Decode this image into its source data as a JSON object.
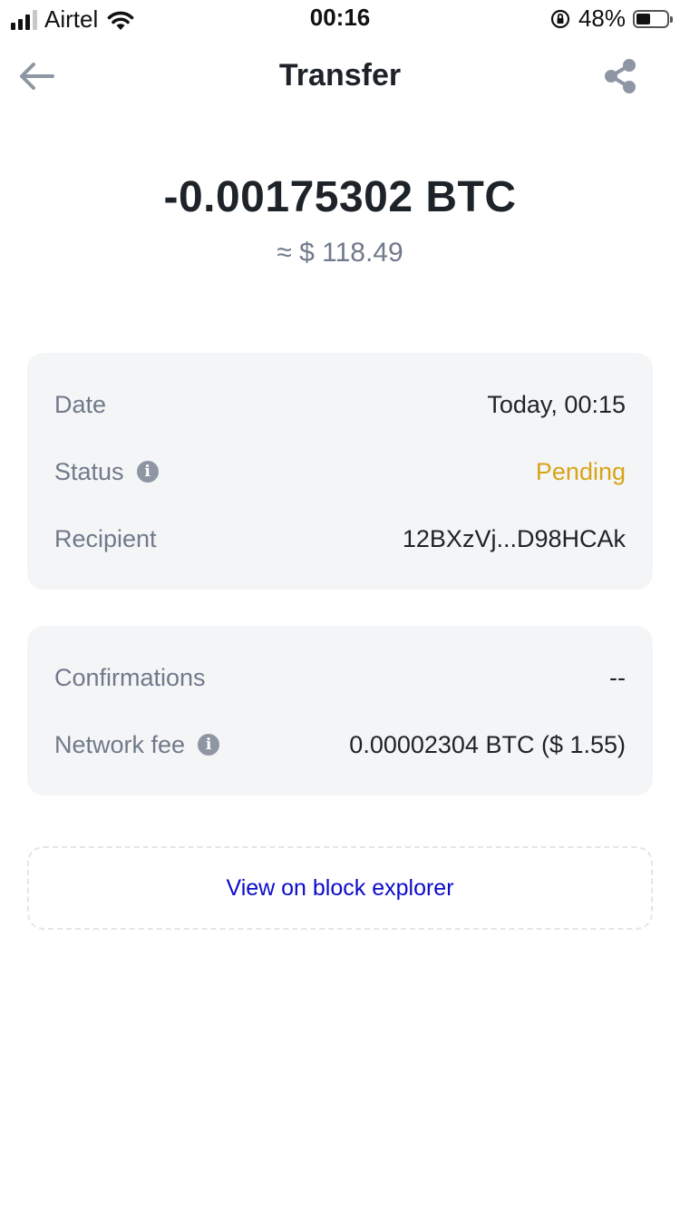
{
  "status_bar": {
    "carrier": "Airtel",
    "time": "00:16",
    "battery_percent_label": "48%",
    "battery_level": 0.48
  },
  "header": {
    "title": "Transfer",
    "back_icon": "arrow-left-icon",
    "share_icon": "share-icon"
  },
  "transaction": {
    "amount": "-0.00175302 BTC",
    "amount_usd": "≈ $ 118.49"
  },
  "details": {
    "date_label": "Date",
    "date_value": "Today, 00:15",
    "status_label": "Status",
    "status_value": "Pending",
    "recipient_label": "Recipient",
    "recipient_value": "12BXzVj...D98HCAk"
  },
  "network": {
    "confirmations_label": "Confirmations",
    "confirmations_value": "--",
    "fee_label": "Network fee",
    "fee_value": "0.00002304 BTC ($ 1.55)"
  },
  "actions": {
    "explorer_label": "View on block explorer"
  },
  "colors": {
    "text_primary": "#1e2329",
    "text_secondary": "#707a8a",
    "pending": "#d8a416",
    "link": "#0b0bc8",
    "card_bg": "#f4f5f7"
  }
}
